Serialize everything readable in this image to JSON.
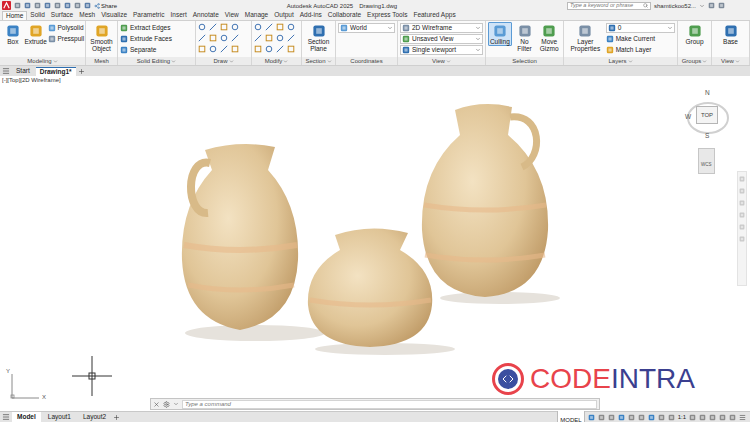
{
  "title_bar": {
    "share": "Share",
    "app_title": "Autodesk AutoCAD 2025",
    "file_name": "Drawing1.dwg",
    "search_placeholder": "Type a keyword or phrase",
    "user": "shamtickoo52..."
  },
  "ribbon_tabs": [
    {
      "label": "Home",
      "selected": true
    },
    {
      "label": "Solid",
      "selected": false
    },
    {
      "label": "Surface",
      "selected": false
    },
    {
      "label": "Mesh",
      "selected": false
    },
    {
      "label": "Visualize",
      "selected": false
    },
    {
      "label": "Parametric",
      "selected": false
    },
    {
      "label": "Insert",
      "selected": false
    },
    {
      "label": "Annotate",
      "selected": false
    },
    {
      "label": "View",
      "selected": false
    },
    {
      "label": "Manage",
      "selected": false
    },
    {
      "label": "Output",
      "selected": false
    },
    {
      "label": "Add-ins",
      "selected": false
    },
    {
      "label": "Collaborate",
      "selected": false
    },
    {
      "label": "Express Tools",
      "selected": false
    },
    {
      "label": "Featured Apps",
      "selected": false
    }
  ],
  "ribbon_panels": [
    {
      "title": "Modeling",
      "expandable": true,
      "kind": "tools",
      "tools": [
        {
          "label": "Box",
          "kind": "large"
        },
        {
          "label": "Extrude",
          "kind": "large"
        },
        {
          "label": "Polysolid",
          "kind": "small"
        },
        {
          "label": "Presspull",
          "kind": "small"
        }
      ]
    },
    {
      "title": "Mesh",
      "expandable": false,
      "kind": "tools",
      "tools": [
        {
          "label": "Smooth Object",
          "kind": "large"
        }
      ]
    },
    {
      "title": "Solid Editing",
      "expandable": true,
      "kind": "tools",
      "tools": [
        {
          "label": "Extract Edges",
          "kind": "small"
        },
        {
          "label": "Extrude Faces",
          "kind": "small"
        },
        {
          "label": "Separate",
          "kind": "small"
        }
      ]
    },
    {
      "title": "Draw",
      "expandable": true,
      "kind": "icon-grid",
      "tools": []
    },
    {
      "title": "Modify",
      "expandable": true,
      "kind": "icon-grid",
      "tools": []
    },
    {
      "title": "Section",
      "expandable": true,
      "kind": "tools",
      "tools": [
        {
          "label": "Section Plane",
          "kind": "large"
        }
      ]
    },
    {
      "title": "Coordinates",
      "expandable": false,
      "kind": "tools",
      "tools": [
        {
          "label": "World",
          "kind": "dropdown"
        }
      ]
    },
    {
      "title": "View",
      "expandable": true,
      "kind": "tools",
      "tools": [
        {
          "label": "2D Wireframe",
          "kind": "dropdown"
        },
        {
          "label": "Unsaved View",
          "kind": "dropdown"
        },
        {
          "label": "Single viewport",
          "kind": "dropdown"
        }
      ]
    },
    {
      "title": "Selection",
      "expandable": false,
      "kind": "tools",
      "tools": [
        {
          "label": "Culling",
          "kind": "large",
          "selected": true
        },
        {
          "label": "No Filter",
          "kind": "large",
          "selected": false
        },
        {
          "label": "Move Gizmo",
          "kind": "large",
          "selected": false
        }
      ]
    },
    {
      "title": "Layers",
      "expandable": true,
      "kind": "tools",
      "tools": [
        {
          "label": "Layer Properties",
          "kind": "large"
        },
        {
          "label": "0",
          "kind": "dropdown"
        },
        {
          "label": "Make Current",
          "kind": "small"
        },
        {
          "label": "Match Layer",
          "kind": "small"
        }
      ]
    },
    {
      "title": "Groups",
      "expandable": true,
      "kind": "tools",
      "tools": [
        {
          "label": "Group",
          "kind": "large"
        }
      ]
    },
    {
      "title": "View",
      "expandable": true,
      "kind": "tools",
      "tools": [
        {
          "label": "Base",
          "kind": "large"
        }
      ]
    }
  ],
  "file_tabs": [
    {
      "label": "Start",
      "selected": false
    },
    {
      "label": "Drawing1*",
      "selected": true
    }
  ],
  "viewport_label": "[-][Top][2D Wireframe]",
  "viewcube": {
    "north": "N",
    "west": "W",
    "face": "TOP",
    "south": "S",
    "ucs": "WCS"
  },
  "ucs_icon": {
    "y": "Y",
    "x": "X"
  },
  "command_line": {
    "placeholder": "Type a command"
  },
  "logo": {
    "part1": "CODE",
    "part2": "INTRA"
  },
  "layout_tabs": [
    {
      "label": "Model",
      "selected": true
    },
    {
      "label": "Layout1",
      "selected": false
    },
    {
      "label": "Layout2",
      "selected": false
    }
  ],
  "status_bar": {
    "space": "MODEL",
    "scale": "1:1"
  }
}
